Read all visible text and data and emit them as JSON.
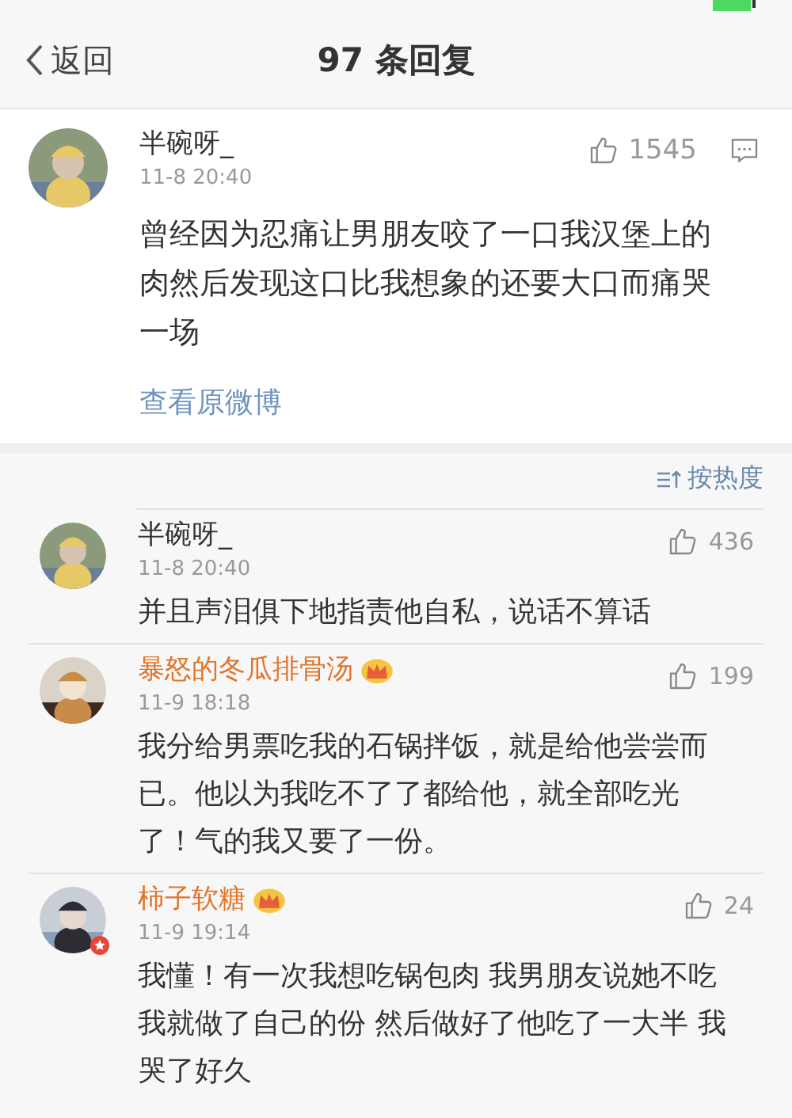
{
  "nav": {
    "back": "返回",
    "title": "97 条回复"
  },
  "post": {
    "author": "半碗呀_",
    "vip": false,
    "avatar_badge": false,
    "time": "11-8 20:40",
    "likes": "1545",
    "text": "曾经因为忍痛让男朋友咬了一口我汉堡上的肉然后发现这口比我想象的还要大口而痛哭一场",
    "link": "查看原微博"
  },
  "sort": {
    "label": "按热度"
  },
  "comments": [
    {
      "author": "半碗呀_",
      "vip": false,
      "avatar_badge": false,
      "time": "11-8 20:40",
      "likes": "436",
      "text": "并且声泪俱下地指责他自私，说话不算话"
    },
    {
      "author": "暴怒的冬瓜排骨汤",
      "vip": true,
      "avatar_badge": false,
      "time": "11-9 18:18",
      "likes": "199",
      "text": "我分给男票吃我的石锅拌饭，就是给他尝尝而已。他以为我吃不了了都给他，就全部吃光了！气的我又要了一份。"
    },
    {
      "author": "柿子软糖",
      "vip": true,
      "avatar_badge": true,
      "time": "11-9 19:14",
      "likes": "24",
      "text": "我懂！有一次我想吃锅包肉 我男朋友说她不吃我就做了自己的份 然后做好了他吃了一大半 我哭了好久"
    }
  ]
}
